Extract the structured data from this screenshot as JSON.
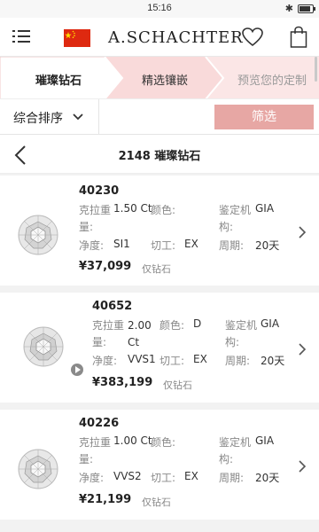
{
  "status": {
    "time": "15:16"
  },
  "header": {
    "logo": "A.SCHACHTER"
  },
  "steps": [
    "璀璨钻石",
    "精选镶嵌",
    "预览您的定制"
  ],
  "filter": {
    "sort_label": "综合排序",
    "filter_button": "筛选"
  },
  "page": {
    "title": "2148 璀璨钻石"
  },
  "labels": {
    "carat": "克拉重量:",
    "color": "颜色:",
    "lab": "鉴定机构:",
    "clarity": "净度:",
    "cut": "切工:",
    "cycle": "周期:"
  },
  "products": [
    {
      "id": "40230",
      "carat": "1.50 Ct",
      "color": "",
      "lab": "GIA",
      "clarity": "SI1",
      "cut": "EX",
      "cycle": "20天",
      "price": "¥37,099",
      "tag": "仅钻石",
      "has_video": false
    },
    {
      "id": "40652",
      "carat": "2.00 Ct",
      "color": "D",
      "lab": "GIA",
      "clarity": "VVS1",
      "cut": "EX",
      "cycle": "20天",
      "price": "¥383,199",
      "tag": "仅钻石",
      "has_video": true
    },
    {
      "id": "40226",
      "carat": "1.00 Ct",
      "color": "",
      "lab": "GIA",
      "clarity": "VVS2",
      "cut": "EX",
      "cycle": "20天",
      "price": "¥21,199",
      "tag": "仅钻石",
      "has_video": false
    }
  ],
  "colors": {
    "accent": "#e7a7a4",
    "step_active_bg": "#f9dada"
  }
}
